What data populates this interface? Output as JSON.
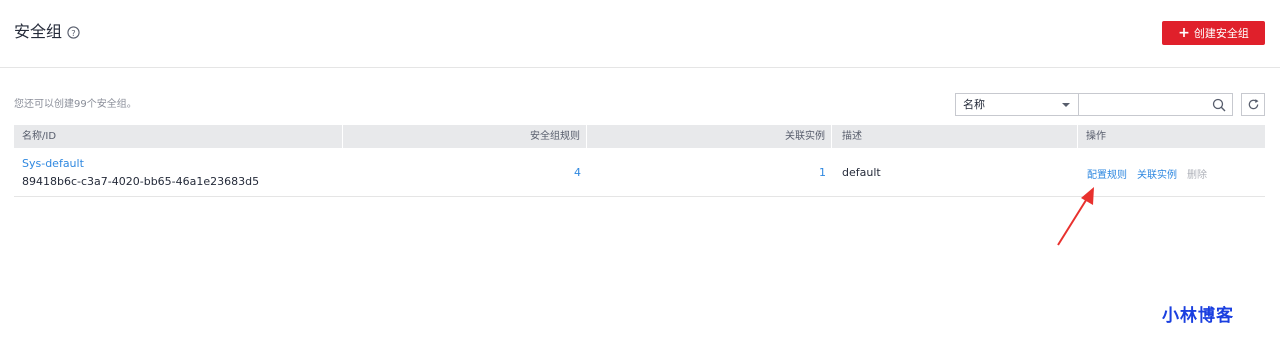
{
  "header": {
    "title": "安全组",
    "create_button_label": "创建安全组"
  },
  "toolbar": {
    "quota_hint": "您还可以创建99个安全组。",
    "filter_selected": "名称",
    "search_value": ""
  },
  "table": {
    "columns": [
      "名称/ID",
      "安全组规则",
      "关联实例",
      "描述",
      "操作"
    ],
    "rows": [
      {
        "name": "Sys-default",
        "id": "89418b6c-c3a7-4020-bb65-46a1e23683d5",
        "rule_count": "4",
        "instance_count": "1",
        "description": "default",
        "actions": [
          "配置规则",
          "关联实例",
          "删除"
        ]
      }
    ]
  },
  "watermark": "小林博客",
  "colors": {
    "primary_button": "#e0202b",
    "link": "#2f88e0",
    "annotation_arrow": "#e8312e",
    "watermark": "#1a3fe0"
  }
}
